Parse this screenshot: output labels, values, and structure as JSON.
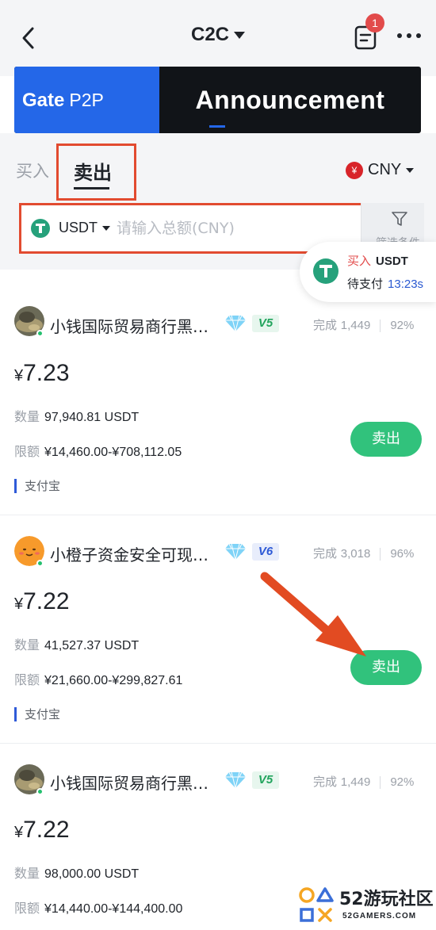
{
  "header": {
    "title": "C2C",
    "order_badge": "1"
  },
  "banner": {
    "brand": "Gate",
    "brand_suffix": "P2P",
    "headline": "Announcement"
  },
  "tabs": {
    "buy": "买入",
    "sell": "卖出"
  },
  "currency": {
    "symbol": "¥",
    "code": "CNY"
  },
  "search": {
    "asset": "USDT",
    "placeholder": "请输入总额(CNY)",
    "filter_label": "筛选条件"
  },
  "pending_order": {
    "side": "买入",
    "asset": "USDT",
    "status": "待支付",
    "countdown": "13:23s"
  },
  "listings": [
    {
      "merchant": "小钱国际贸易商行黑…",
      "level": "V5",
      "completed_label": "完成",
      "completed": "1,449",
      "rate": "92%",
      "currency_symbol": "¥",
      "price": "7.23",
      "quantity_label": "数量",
      "quantity": "97,940.81 USDT",
      "limit_label": "限额",
      "limit": "¥14,460.00-¥708,112.05",
      "action": "卖出",
      "payment": "支付宝"
    },
    {
      "merchant": "小橙子资金安全可现…",
      "level": "V6",
      "completed_label": "完成",
      "completed": "3,018",
      "rate": "96%",
      "currency_symbol": "¥",
      "price": "7.22",
      "quantity_label": "数量",
      "quantity": "41,527.37 USDT",
      "limit_label": "限额",
      "limit": "¥21,660.00-¥299,827.61",
      "action": "卖出",
      "payment": "支付宝"
    },
    {
      "merchant": "小钱国际贸易商行黑…",
      "level": "V5",
      "completed_label": "完成",
      "completed": "1,449",
      "rate": "92%",
      "currency_symbol": "¥",
      "price": "7.22",
      "quantity_label": "数量",
      "quantity": "98,000.00 USDT",
      "limit_label": "限额",
      "limit": "¥14,440.00-¥144,400.00"
    }
  ],
  "watermark": {
    "title": "52游玩社区",
    "url": "52GAMERS.COM"
  },
  "colors": {
    "accent_green": "#31c27c",
    "highlight_red": "#e24b30",
    "brand_blue": "#2467e8"
  }
}
